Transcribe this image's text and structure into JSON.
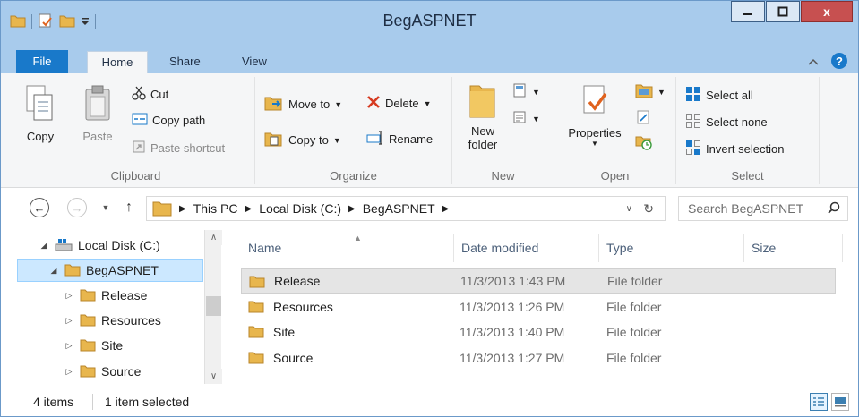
{
  "window": {
    "title": "BegASPNET",
    "close_label": "x"
  },
  "ribbon_tabs": {
    "file": "File",
    "home": "Home",
    "share": "Share",
    "view": "View",
    "help": "?"
  },
  "clipboard": {
    "copy": "Copy",
    "paste": "Paste",
    "cut": "Cut",
    "copy_path": "Copy path",
    "paste_shortcut": "Paste shortcut",
    "label": "Clipboard"
  },
  "organize": {
    "move_to": "Move to",
    "copy_to": "Copy to",
    "delete": "Delete",
    "rename": "Rename",
    "label": "Organize"
  },
  "new_group": {
    "new_folder_line1": "New",
    "new_folder_line2": "folder",
    "label": "New"
  },
  "open_group": {
    "properties": "Properties",
    "label": "Open"
  },
  "select_group": {
    "select_all": "Select all",
    "select_none": "Select none",
    "invert_selection": "Invert selection",
    "label": "Select"
  },
  "address": {
    "crumbs": [
      "This PC",
      "Local Disk (C:)",
      "BegASPNET"
    ],
    "search_placeholder": "Search BegASPNET"
  },
  "tree": {
    "items": [
      {
        "label": "Local Disk (C:)",
        "icon": "drive-icon",
        "expanded": true,
        "selected": false
      },
      {
        "label": "BegASPNET",
        "icon": "folder-icon",
        "expanded": true,
        "selected": true
      },
      {
        "label": "Release",
        "icon": "folder-icon",
        "expanded": false,
        "selected": false
      },
      {
        "label": "Resources",
        "icon": "folder-icon",
        "expanded": false,
        "selected": false
      },
      {
        "label": "Site",
        "icon": "folder-icon",
        "expanded": false,
        "selected": false
      },
      {
        "label": "Source",
        "icon": "folder-icon",
        "expanded": false,
        "selected": false
      }
    ]
  },
  "list": {
    "columns": [
      "Name",
      "Date modified",
      "Type",
      "Size"
    ],
    "rows": [
      {
        "name": "Release",
        "date": "11/3/2013 1:43 PM",
        "type": "File folder",
        "size": ""
      },
      {
        "name": "Resources",
        "date": "11/3/2013 1:26 PM",
        "type": "File folder",
        "size": ""
      },
      {
        "name": "Site",
        "date": "11/3/2013 1:40 PM",
        "type": "File folder",
        "size": ""
      },
      {
        "name": "Source",
        "date": "11/3/2013 1:27 PM",
        "type": "File folder",
        "size": ""
      }
    ]
  },
  "status": {
    "item_count": "4 items",
    "selection": "1 item selected"
  },
  "colors": {
    "titlebar": "#a8cbec",
    "file_tab": "#1979ca",
    "selection": "#cce8ff",
    "folder": "#e8b64d"
  }
}
